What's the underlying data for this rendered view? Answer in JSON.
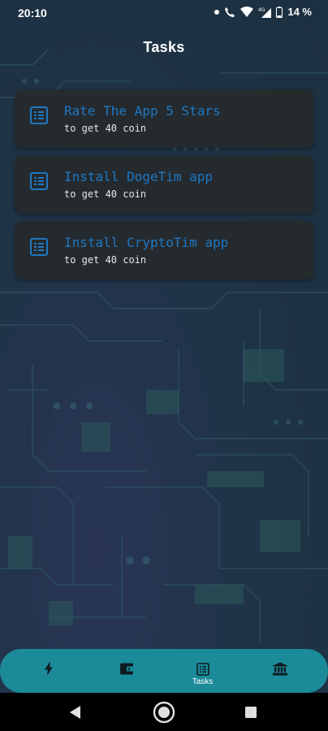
{
  "status_bar": {
    "time": "20:10",
    "battery_percent": "14 %",
    "network_label": "4G",
    "icons": [
      "notification-dot-icon",
      "wifi-call-icon",
      "wifi-icon",
      "signal-icon",
      "battery-icon"
    ]
  },
  "header": {
    "title": "Tasks"
  },
  "tasks": [
    {
      "title": "Rate The App 5 Stars",
      "subtitle": "to get 40 coin",
      "icon": "task-list-icon"
    },
    {
      "title": "Install DogeTim app",
      "subtitle": "to get 40 coin",
      "icon": "task-list-icon"
    },
    {
      "title": "Install CryptoTim app",
      "subtitle": "to get 40 coin",
      "icon": "task-list-icon"
    }
  ],
  "bottom_nav": {
    "items": [
      {
        "icon": "lightning-icon",
        "label": ""
      },
      {
        "icon": "wallet-icon",
        "label": ""
      },
      {
        "icon": "tasks-icon",
        "label": "Tasks",
        "active": true
      },
      {
        "icon": "bank-icon",
        "label": ""
      }
    ]
  },
  "system_nav": {
    "buttons": [
      "back-icon",
      "home-icon",
      "recents-icon"
    ]
  },
  "colors": {
    "task_title": "#1e78c2",
    "nav_bar": "#1b8a99",
    "card_bg": "#26292b"
  }
}
